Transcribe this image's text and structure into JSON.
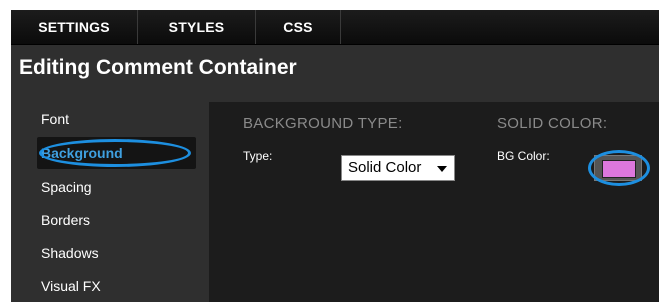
{
  "tabs": [
    {
      "label": "SETTINGS"
    },
    {
      "label": "STYLES"
    },
    {
      "label": "CSS"
    }
  ],
  "page_title": "Editing Comment Container",
  "sidebar": {
    "items": [
      {
        "label": "Font"
      },
      {
        "label": "Background",
        "active": true
      },
      {
        "label": "Spacing"
      },
      {
        "label": "Borders"
      },
      {
        "label": "Shadows"
      },
      {
        "label": "Visual FX"
      }
    ]
  },
  "background_type": {
    "heading": "BACKGROUND TYPE:",
    "type_label": "Type:",
    "type_value": "Solid Color"
  },
  "solid_color": {
    "heading": "SOLID COLOR:",
    "bg_color_label": "BG Color:",
    "bg_color_value": "#dd77dd"
  },
  "colors": {
    "accent": "#1d8fe0",
    "active_text": "#3fa0e0",
    "panel_bg": "#1c1c1c",
    "frame_bg": "#2f2f2f"
  },
  "icons": {
    "dropdown": "chevron-down-icon"
  }
}
